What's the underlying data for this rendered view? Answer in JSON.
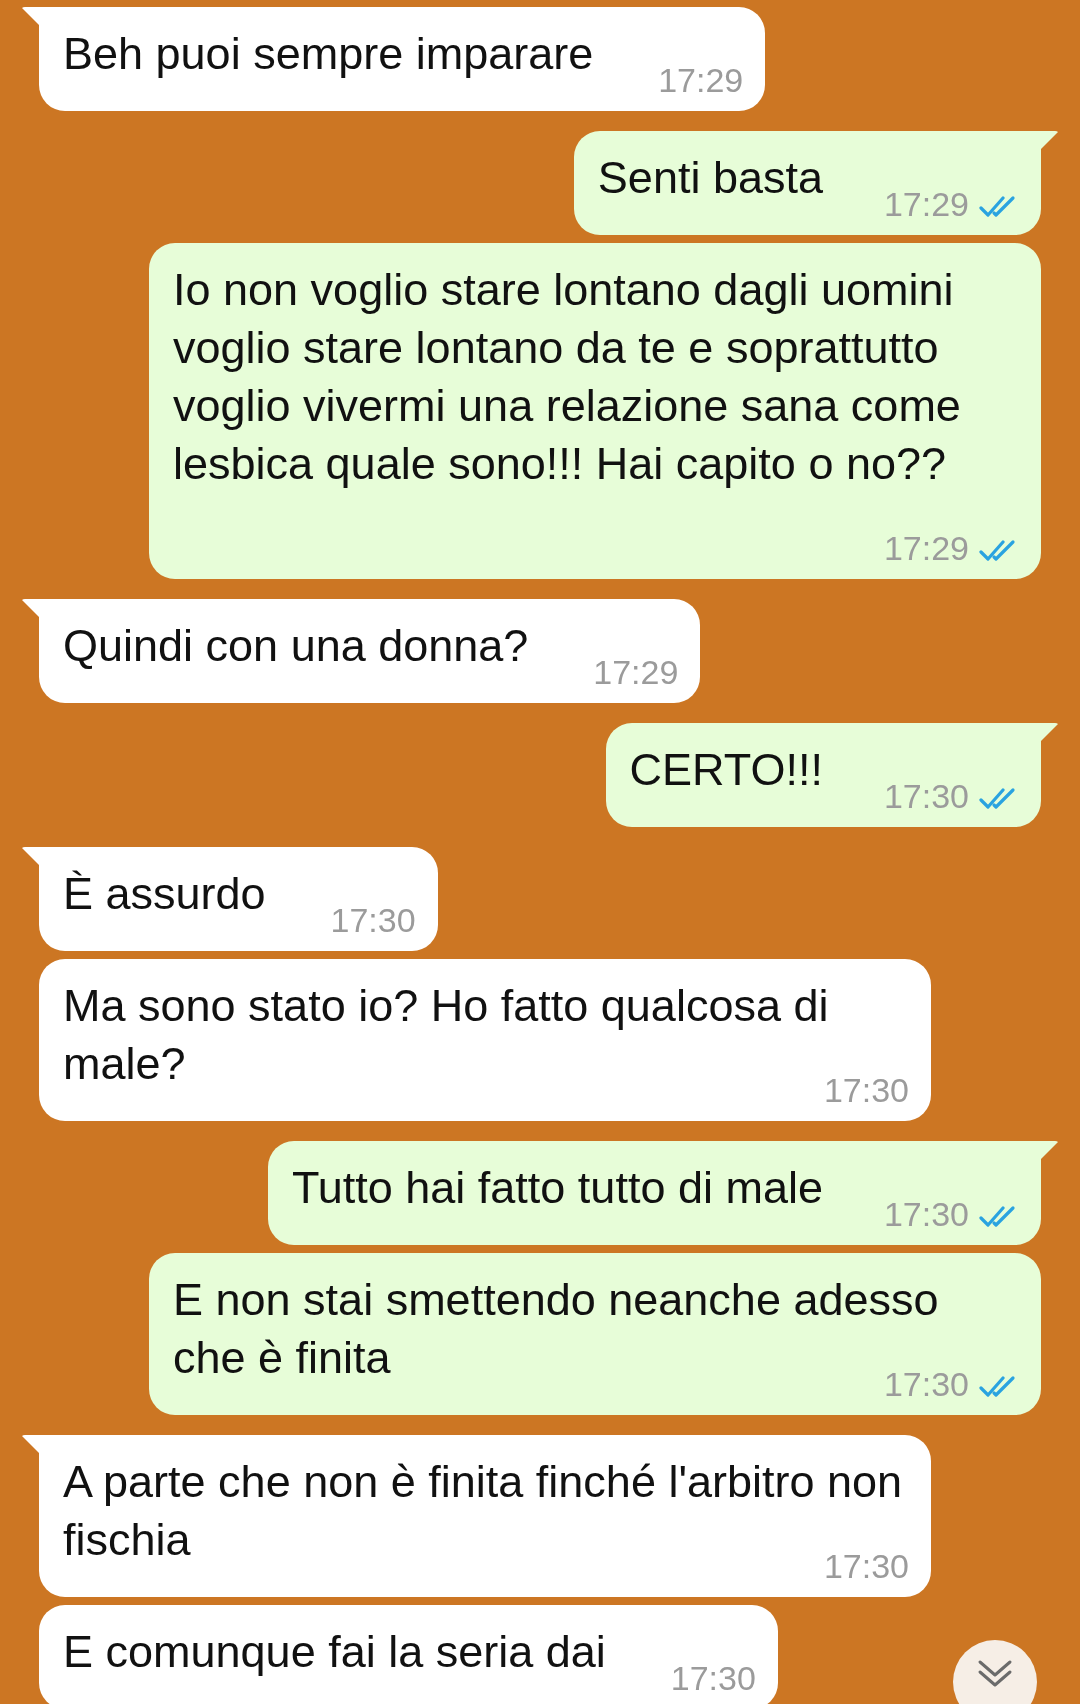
{
  "messages": [
    {
      "kind": "incoming",
      "tail": true,
      "text": "Beh puoi sempre imparare",
      "time": "17:29"
    },
    {
      "kind": "outgoing",
      "tail": true,
      "text": "Senti basta",
      "time": "17:29",
      "read": true
    },
    {
      "kind": "outgoing",
      "tail": false,
      "text": "Io non voglio stare lontano dagli uomini voglio stare lontano da te e soprattutto voglio vivermi una relazione sana come lesbica quale sono!!! Hai capito o no??",
      "time": "17:29",
      "read": true
    },
    {
      "kind": "incoming",
      "tail": true,
      "text": "Quindi con una donna?",
      "time": "17:29"
    },
    {
      "kind": "outgoing",
      "tail": true,
      "text": "CERTO!!!",
      "time": "17:30",
      "read": true
    },
    {
      "kind": "incoming",
      "tail": true,
      "text": "È assurdo",
      "time": "17:30"
    },
    {
      "kind": "incoming",
      "tail": false,
      "text": "Ma sono stato io? Ho fatto qualcosa di male?",
      "time": "17:30"
    },
    {
      "kind": "outgoing",
      "tail": true,
      "text": "Tutto hai fatto tutto di male",
      "time": "17:30",
      "read": true
    },
    {
      "kind": "outgoing",
      "tail": false,
      "text": "E non stai smettendo neanche adesso che è finita",
      "time": "17:30",
      "read": true
    },
    {
      "kind": "incoming",
      "tail": true,
      "text": "A parte che non è finita finché l'arbitro non fischia",
      "time": "17:30"
    },
    {
      "kind": "incoming",
      "tail": false,
      "text": "E comunque fai la seria dai",
      "time": "17:30"
    }
  ]
}
